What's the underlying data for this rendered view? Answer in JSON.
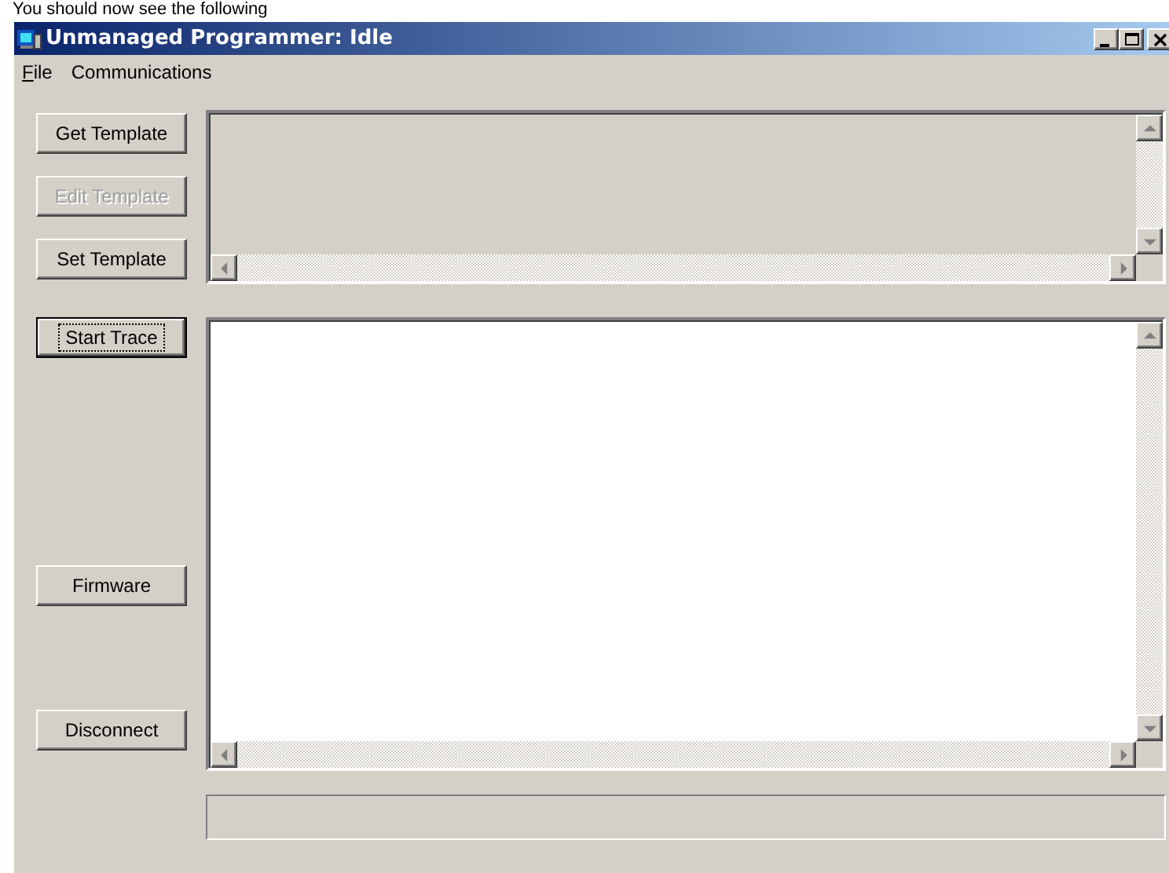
{
  "caption": {
    "text": "You should now see the following"
  },
  "window": {
    "title": "Unmanaged Programmer: Idle",
    "controls": [
      {
        "kind": "minimize"
      },
      {
        "kind": "maximize"
      },
      {
        "kind": "close"
      }
    ]
  },
  "menu": [
    {
      "label": "File",
      "underline_first": true
    },
    {
      "label": "Communications",
      "underline_first": false
    }
  ],
  "template_buttons": [
    {
      "label": "Get Template",
      "disabled": false,
      "focused": false
    },
    {
      "label": "Edit Template",
      "disabled": true,
      "focused": false
    },
    {
      "label": "Set Template",
      "disabled": false,
      "focused": false
    }
  ],
  "trace_buttons": [
    {
      "label": "Start Trace",
      "disabled": false,
      "focused": true
    },
    {
      "label": "Firmware",
      "disabled": false,
      "focused": false
    },
    {
      "label": "Disconnect",
      "disabled": false,
      "focused": false
    }
  ],
  "template_view": {
    "readonly": true
  },
  "trace_view": {
    "readonly": false
  },
  "status_field": {
    "readonly": true
  }
}
